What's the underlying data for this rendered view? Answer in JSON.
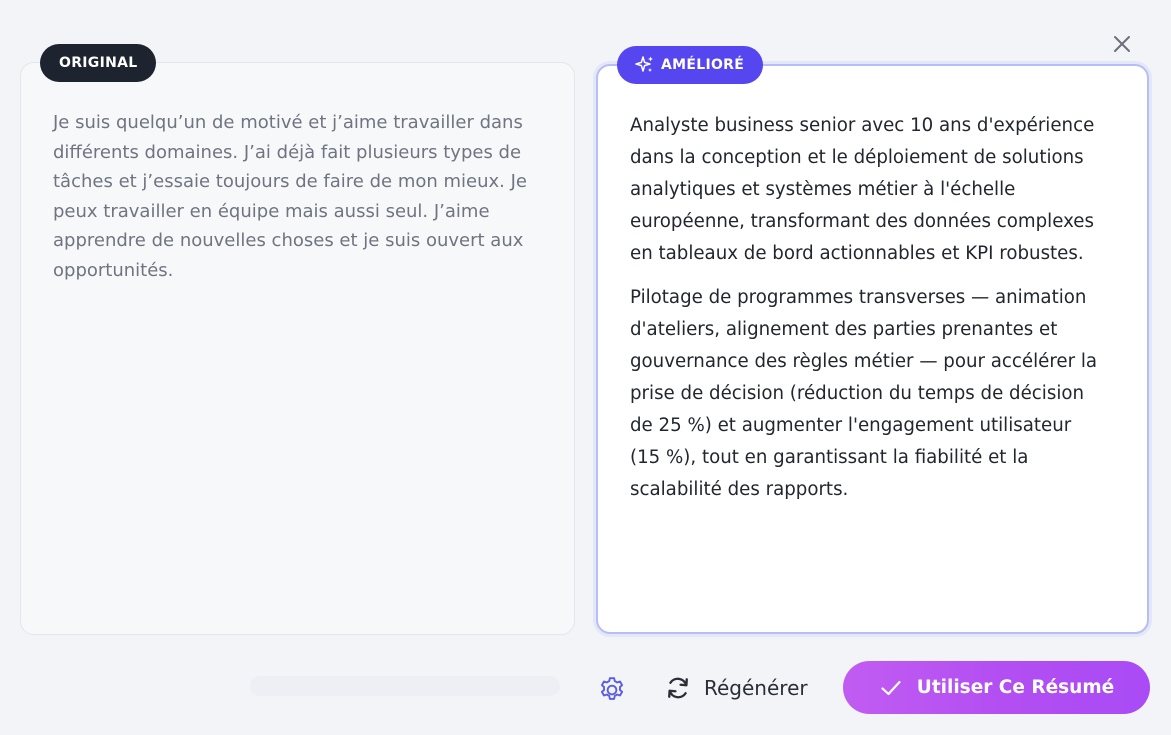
{
  "panels": {
    "original": {
      "badge_label": "ORIGINAL",
      "text": "Je suis quelqu’un de motivé et j’aime travailler dans différents domaines. J’ai déjà fait plusieurs types de tâches et j’essaie toujours de faire de mon mieux. Je peux travailler en équipe mais aussi seul. J’aime apprendre de nouvelles choses et je suis ouvert aux opportunités."
    },
    "improved": {
      "badge_label": "AMÉLIORÉ",
      "badge_icon": "sparkles-icon",
      "paragraphs": [
        "Analyste business senior avec 10 ans d'expérience dans la conception et le déploiement de solutions analytiques et systèmes métier à l'échelle européenne, transformant des données complexes en tableaux de bord actionnables et KPI robustes.",
        "Pilotage de programmes transverses — animation d'ateliers, alignement des parties prenantes et gouvernance des règles métier — pour accélérer la prise de décision (réduction du temps de décision de 25 %) et augmenter l'engagement utilisateur (15 %), tout en garantissant la fiabilité et la scalabilité des rapports."
      ]
    }
  },
  "footer": {
    "settings_icon": "gear-icon",
    "regenerate_icon": "refresh-icon",
    "regenerate_label": "Régénérer",
    "use_icon": "check-icon",
    "use_label": "Utiliser Ce Résumé"
  },
  "window": {
    "close_icon": "close-icon"
  },
  "colors": {
    "original_badge": "#1e2330",
    "improved_badge": "#5546ef",
    "improved_border": "#b7bef7",
    "use_button": "#b24ef2",
    "icon_accent": "#5b5ce6"
  }
}
